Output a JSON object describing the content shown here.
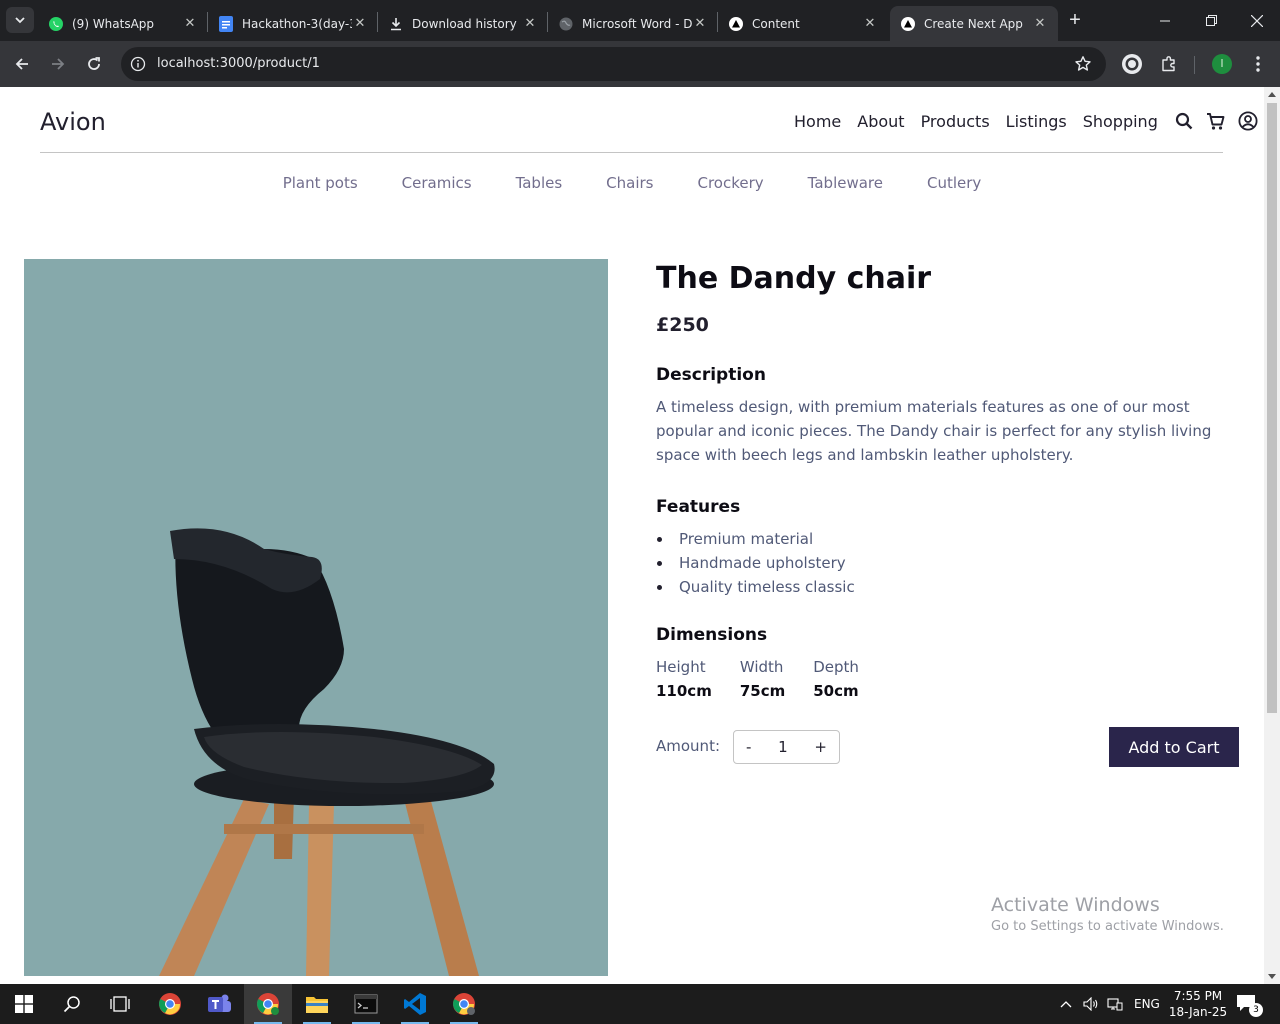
{
  "browser": {
    "tabs": [
      {
        "title": "(9) WhatsApp",
        "icon": "whatsapp-icon"
      },
      {
        "title": "Hackathon-3(day-3",
        "icon": "google-docs-icon"
      },
      {
        "title": "Download history",
        "icon": "download-icon"
      },
      {
        "title": "Microsoft Word - D",
        "icon": "globe-icon"
      },
      {
        "title": "Content",
        "icon": "nextjs-icon"
      },
      {
        "title": "Create Next App",
        "icon": "nextjs-icon",
        "active": true
      }
    ],
    "url": "localhost:3000/product/1",
    "profile_initial": "I"
  },
  "site": {
    "brand": "Avion",
    "nav": [
      "Home",
      "About",
      "Products",
      "Listings",
      "Shopping"
    ],
    "categories": [
      "Plant pots",
      "Ceramics",
      "Tables",
      "Chairs",
      "Crockery",
      "Tableware",
      "Cutlery"
    ]
  },
  "product": {
    "title": "The Dandy chair",
    "price": "£250",
    "description_heading": "Description",
    "description": "A timeless design, with premium materials features as one of our most popular and iconic pieces. The Dandy chair is perfect for any stylish living space with beech legs and lambskin leather upholstery.",
    "features_heading": "Features",
    "features": [
      "Premium material",
      "Handmade upholstery",
      "Quality timeless classic"
    ],
    "dimensions_heading": "Dimensions",
    "dimensions": [
      {
        "label": "Height",
        "value": "110cm"
      },
      {
        "label": "Width",
        "value": "75cm"
      },
      {
        "label": "Depth",
        "value": "50cm"
      }
    ],
    "amount_label": "Amount:",
    "quantity": "1",
    "decrement": "-",
    "increment": "+",
    "add_to_cart": "Add to Cart"
  },
  "watermark": {
    "line1": "Activate Windows",
    "line2": "Go to Settings to activate Windows."
  },
  "taskbar": {
    "language": "ENG",
    "time": "7:55 PM",
    "date": "18-Jan-25",
    "notification_count": "3"
  },
  "colors": {
    "accent": "#2a254b",
    "image_bg": "#86a9ab",
    "text_muted": "#505977",
    "category_text": "#726e8d"
  }
}
